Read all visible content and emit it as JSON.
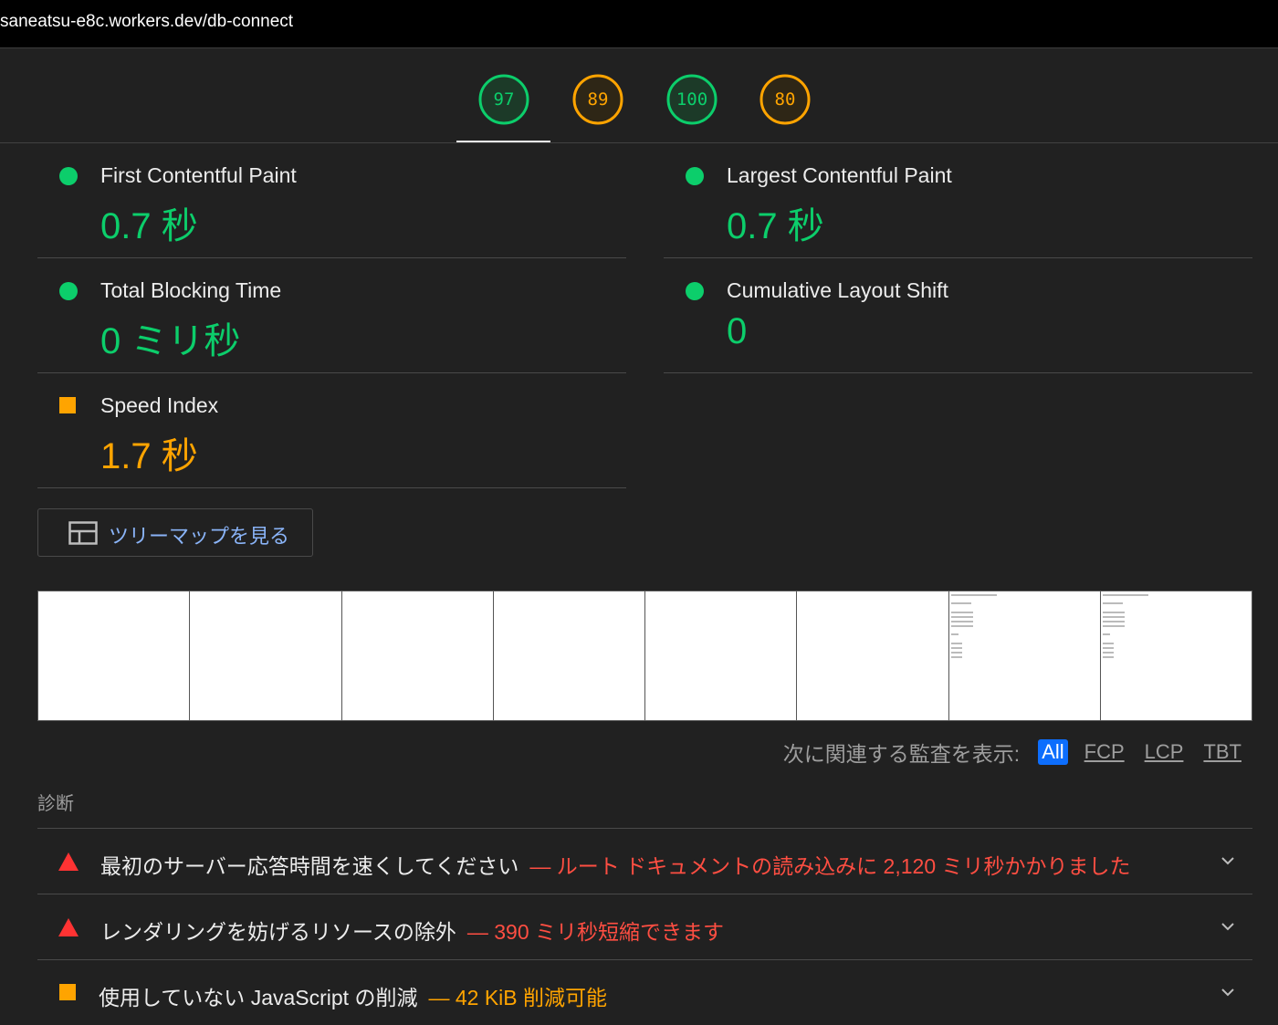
{
  "browser": {
    "url": "saneatsu-e8c.workers.dev/db-connect"
  },
  "gauges": [
    {
      "name": "performance",
      "score": "97",
      "color": "#0cce6b",
      "fraction": 0.97
    },
    {
      "name": "accessibility",
      "score": "89",
      "color": "#ffa400",
      "fraction": 0.89
    },
    {
      "name": "best-practices",
      "score": "100",
      "color": "#0cce6b",
      "fraction": 1.0
    },
    {
      "name": "seo",
      "score": "80",
      "color": "#ffa400",
      "fraction": 0.8
    }
  ],
  "metrics": {
    "fcp": {
      "title": "First Contentful Paint",
      "value": "0.7 秒",
      "status": "pass"
    },
    "lcp": {
      "title": "Largest Contentful Paint",
      "value": "0.7 秒",
      "status": "pass"
    },
    "tbt": {
      "title": "Total Blocking Time",
      "value": "0 ミリ秒",
      "status": "pass"
    },
    "cls": {
      "title": "Cumulative Layout Shift",
      "value": "0",
      "status": "pass"
    },
    "si": {
      "title": "Speed Index",
      "value": "1.7 秒",
      "status": "average"
    }
  },
  "treemap": {
    "label": "ツリーマップを見る",
    "icon": "treemap-icon"
  },
  "filmstrip": {
    "frames": 8,
    "frames_with_content": [
      7,
      8
    ]
  },
  "filter": {
    "label": "次に関連する監査を表示:",
    "chips": [
      "All",
      "FCP",
      "LCP",
      "TBT"
    ],
    "active": "All"
  },
  "diagnostics": {
    "heading": "診断",
    "items": [
      {
        "title": "最初のサーバー応答時間を速くしてください",
        "detail": "— ルート ドキュメントの読み込みに 2,120 ミリ秒かかりました",
        "severity": "fail",
        "color": "#ff4e42"
      },
      {
        "title": "レンダリングを妨げるリソースの除外",
        "detail": "— 390 ミリ秒短縮できます",
        "severity": "fail",
        "color": "#ff4e42"
      },
      {
        "title": "使用していない JavaScript の削減",
        "detail": "— 42 KiB 削減可能",
        "severity": "average",
        "color": "#ffa400"
      }
    ]
  }
}
